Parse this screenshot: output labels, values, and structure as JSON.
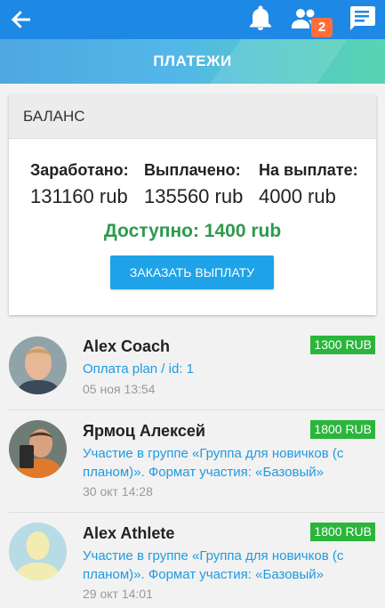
{
  "header": {
    "notifications_badge": "2",
    "title": "ПЛАТЕЖИ"
  },
  "balance": {
    "title": "БАЛАНС",
    "stats": [
      {
        "label": "Заработано:",
        "value": "131160 rub"
      },
      {
        "label": "Выплачено:",
        "value": "135560 rub"
      },
      {
        "label": "На выплате:",
        "value": "4000 rub"
      }
    ],
    "available": "Доступно: 1400 rub",
    "order_button": "ЗАКАЗАТЬ ВЫПЛАТУ"
  },
  "payments": [
    {
      "name": "Alex Coach",
      "description": "Оплата plan / id: 1",
      "date": "05 ноя 13:54",
      "amount": "1300 RUB"
    },
    {
      "name": "Ярмоц Алексей",
      "description": "Участие в группе «Группа для новичков (с планом)». Формат участия: «Базовый»",
      "date": "30 окт 14:28",
      "amount": "1800 RUB"
    },
    {
      "name": "Alex Athlete",
      "description": "Участие в группе «Группа для новичков (с планом)». Формат участия: «Базовый»",
      "date": "29 окт 14:01",
      "amount": "1800 RUB"
    }
  ],
  "colors": {
    "app_bar": "#1e88e5",
    "accent_green": "#2e9a4e",
    "amount_badge": "#2bb53b",
    "link_blue": "#1e9be0",
    "badge_orange": "#ff6f3c"
  },
  "icons": [
    "back-arrow-icon",
    "bell-icon",
    "people-icon",
    "chat-icon"
  ]
}
